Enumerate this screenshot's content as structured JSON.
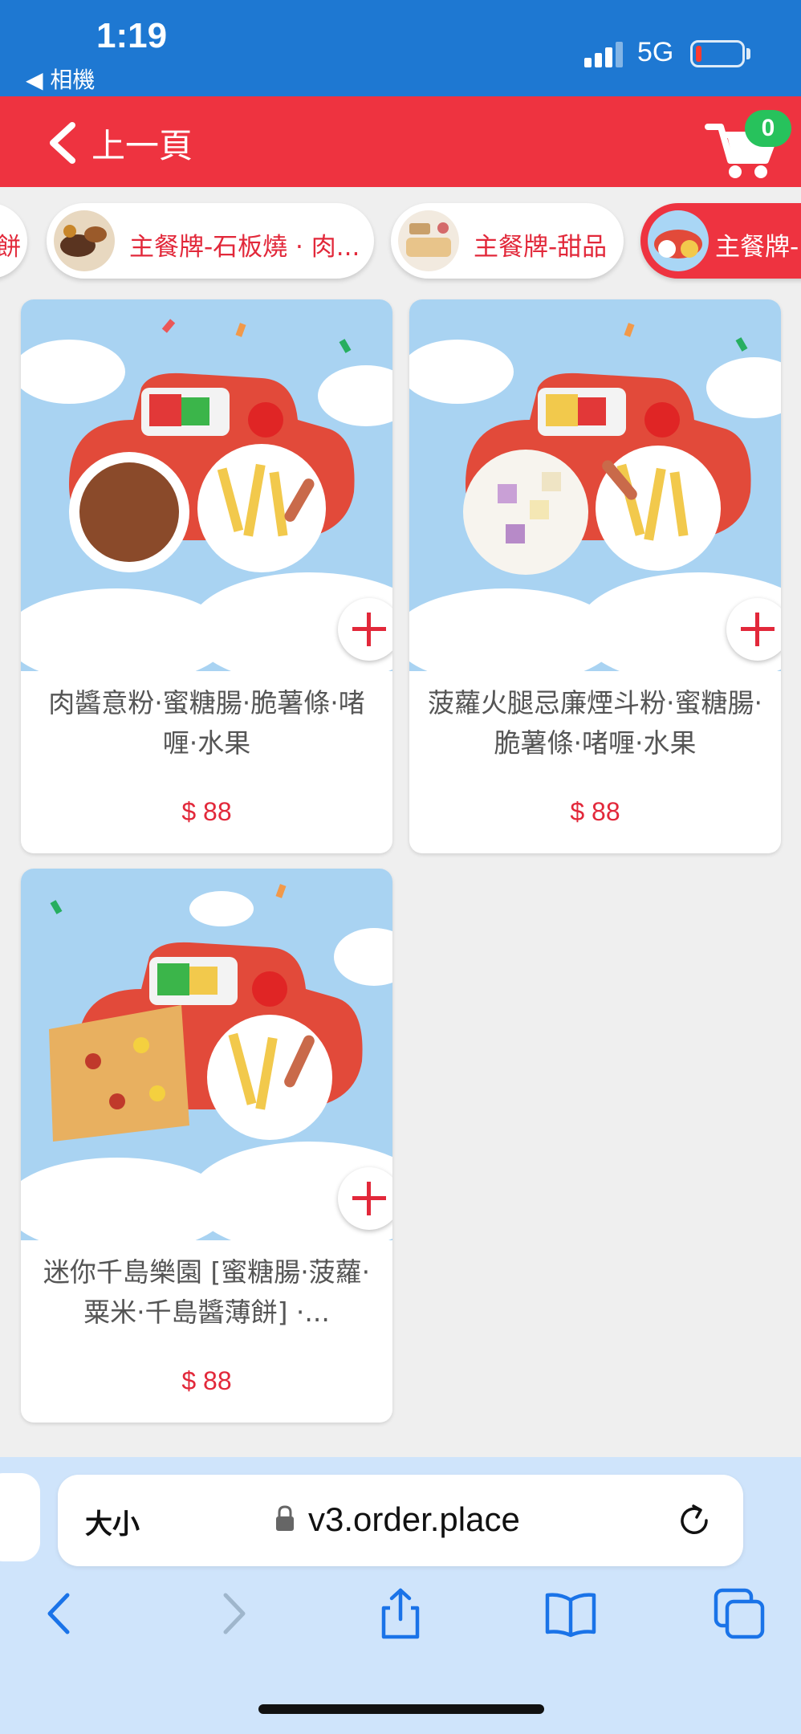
{
  "status_bar": {
    "time": "1:19",
    "back_app": "◀ 相機",
    "network": "5G"
  },
  "header": {
    "back_label": "上一頁",
    "cart_count": "0"
  },
  "categories": [
    {
      "label": "餅",
      "active": false
    },
    {
      "label": "主餐牌-石板燒 · 肉...",
      "active": false
    },
    {
      "label": "主餐牌-甜品",
      "active": false
    },
    {
      "label": "主餐牌-",
      "active": true
    }
  ],
  "products": [
    {
      "name": "肉醬意粉·蜜糖腸·脆薯條·啫喱·水果",
      "price": "$ 88"
    },
    {
      "name": "菠蘿火腿忌廉煙斗粉·蜜糖腸·脆薯條·啫喱·水果",
      "price": "$ 88"
    },
    {
      "name": "迷你千島樂園 [蜜糖腸·菠蘿·粟米·千島醬薄餅] ·...",
      "price": "$ 88"
    }
  ],
  "browser": {
    "text_size_label": "大小",
    "url": "v3.order.place"
  },
  "colors": {
    "status_blue": "#1e78d2",
    "brand_red": "#ee3340",
    "price_red": "#e2283a",
    "badge_green": "#27c25c",
    "browser_bg": "#cfe4fb"
  },
  "icons": [
    "back-chevron-icon",
    "cart-icon",
    "plus-icon",
    "lock-icon",
    "reload-icon",
    "browser-back-icon",
    "browser-forward-icon",
    "share-icon",
    "bookmarks-icon",
    "tabs-icon"
  ]
}
